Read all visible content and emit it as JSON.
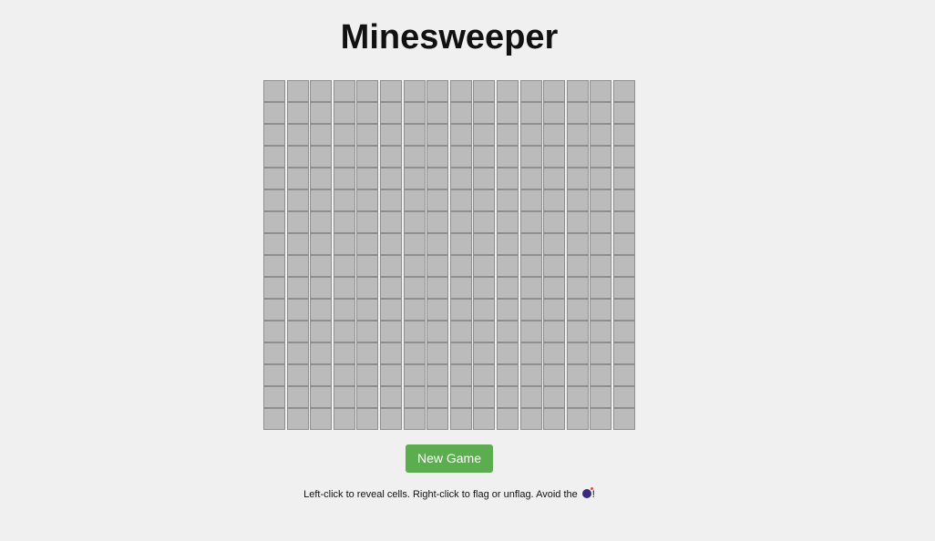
{
  "title": "Minesweeper",
  "board": {
    "rows": 16,
    "cols": 16,
    "cell_state": "hidden",
    "cell_color": "#bbbbbb",
    "cell_border_color": "#8f8f8f"
  },
  "new_game_button": {
    "label": "New Game",
    "color": "#5cad4f"
  },
  "instructions": {
    "text_before": "Left-click to reveal cells. Right-click to flag or unflag. Avoid the",
    "icon": "bomb-icon",
    "text_after": "!"
  },
  "background_color": "#f0f0f0"
}
